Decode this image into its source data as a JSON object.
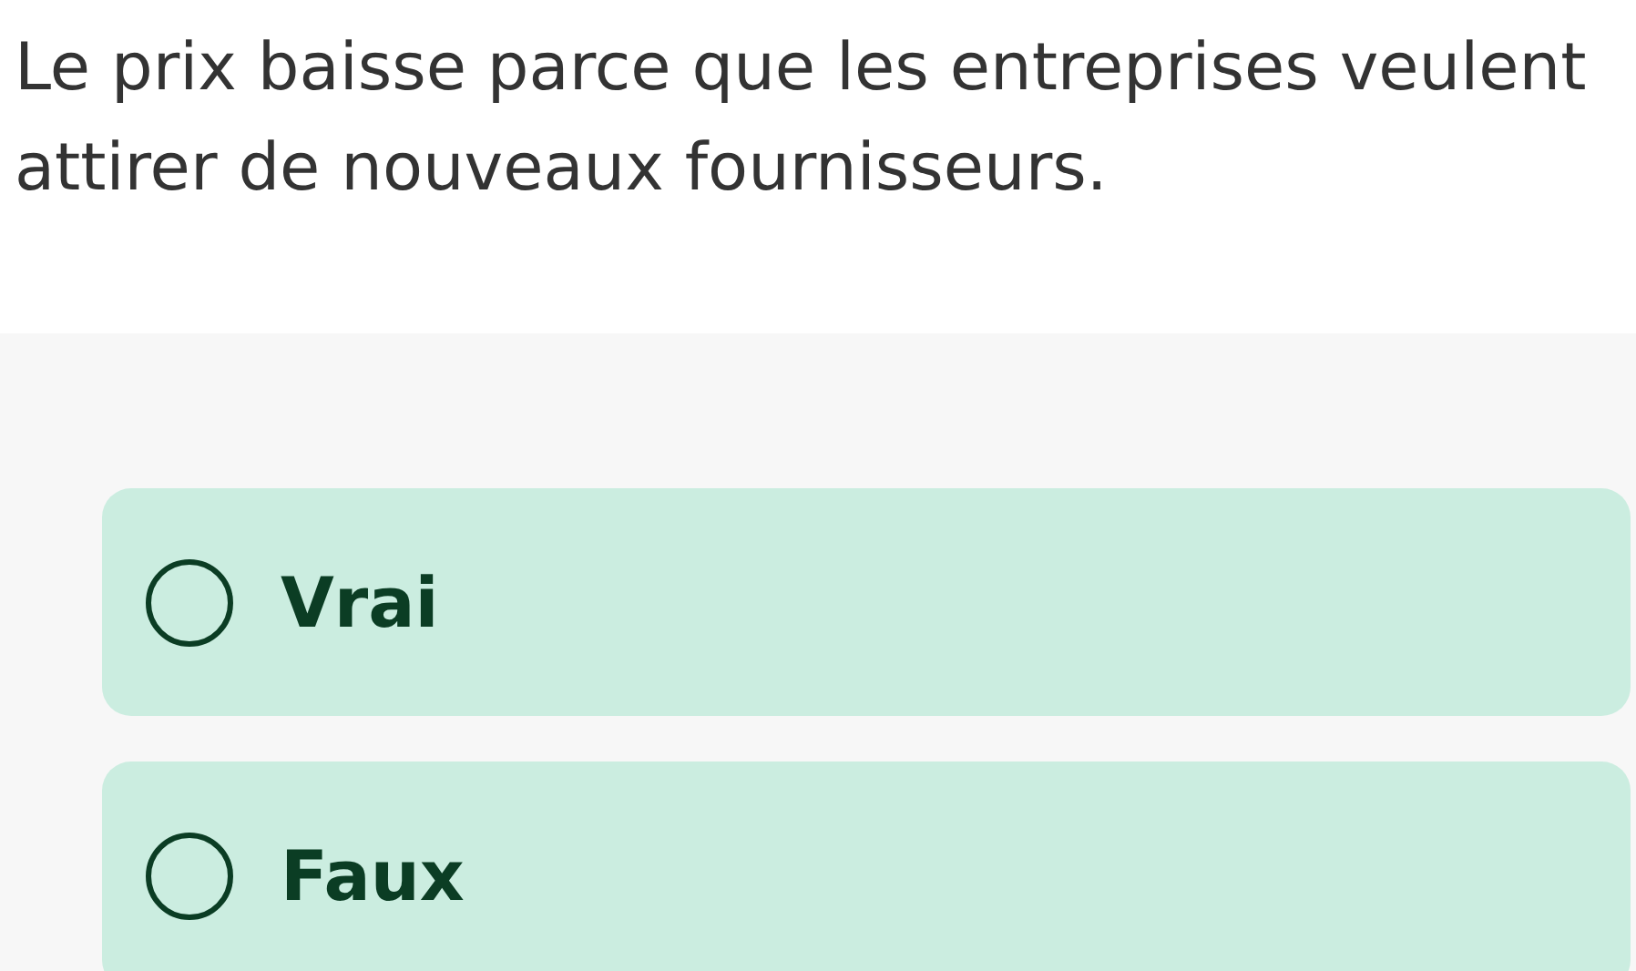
{
  "question": "Le prix baisse parce que les entreprises veulent attirer de nouveaux fournisseurs.",
  "options": [
    {
      "label": "Vrai",
      "selected": false
    },
    {
      "label": "Faux",
      "selected": false
    }
  ]
}
